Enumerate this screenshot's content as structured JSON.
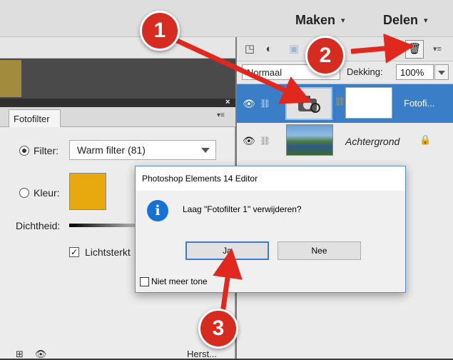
{
  "header": {
    "maken": "Maken",
    "delen": "Delen",
    "caret": "▾"
  },
  "fotofilter": {
    "close": "×",
    "tab_label": "Fotofilter",
    "tab_menu": "▾≡",
    "filter_label": "Filter:",
    "filter_value": "Warm filter (81)",
    "color_label": "Kleur:",
    "color_value": "#e8a90f",
    "density_label": "Dichtheid:",
    "preserve_label": "Lichtsterkt",
    "preserve_checked": "✓",
    "bottom_reset": "Herst..."
  },
  "layers": {
    "blend_mode": "Normaal",
    "opacity_label": "Dekking:",
    "opacity_value": "100%",
    "menu_icon": "▾≡",
    "items": [
      {
        "name": "Fotofi...",
        "selected": true
      },
      {
        "name": "Achtergrond",
        "selected": false
      }
    ]
  },
  "dialog": {
    "title": "Photoshop Elements 14 Editor",
    "icon_glyph": "i",
    "message": "Laag \"Fotofilter 1\" verwijderen?",
    "yes_label": "Ja",
    "no_label": "Nee",
    "dont_show_label": "Niet meer tone"
  },
  "callouts": {
    "one": "1",
    "two": "2",
    "three": "3"
  },
  "colors": {
    "callout_red": "#d62b1f",
    "selection_blue": "#3b7ec8",
    "accent_blue": "#1673d6"
  }
}
